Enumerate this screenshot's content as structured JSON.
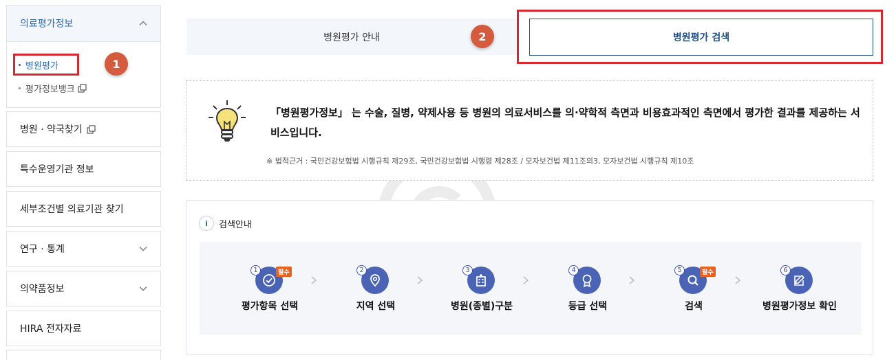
{
  "sidebar": {
    "group_title": "의료평가정보",
    "sub_items": [
      {
        "label": "병원평가"
      },
      {
        "label": "평가정보뱅크"
      }
    ],
    "items": [
      {
        "label": "병원 · 약국찾기"
      },
      {
        "label": "특수운영기관 정보"
      },
      {
        "label": "세부조건별 의료기관 찾기"
      },
      {
        "label": "연구 · 통계"
      },
      {
        "label": "의약품정보"
      },
      {
        "label": "HIRA 전자자료"
      }
    ]
  },
  "markers": {
    "one": "1",
    "two": "2"
  },
  "tabs": {
    "guide": "병원평가 안내",
    "search": "병원평가 검색"
  },
  "info": {
    "main": "「병원평가정보」 는 수술, 질병, 약제사용 등 병원의 의료서비스를 의·약학적 측면과 비용효과적인 측면에서 평가한 결과를 제공하는 서비스입니다.",
    "law": "※ 법적근거 : 국민건강보험법 시행규칙 제29조, 국민건강보험법 시행령 제28조 / 모자보건법 제11조의3, 모자보건법 시행규칙 제10조"
  },
  "guide": {
    "icon_text": "i",
    "title": "검색안내",
    "required": "필수",
    "steps": [
      {
        "num": "1",
        "label": "평가항목 선택",
        "icon": "check-icon"
      },
      {
        "num": "2",
        "label": "지역 선택",
        "icon": "location-pin-icon"
      },
      {
        "num": "3",
        "label": "병원(종별)구분",
        "icon": "hospital-building-icon"
      },
      {
        "num": "4",
        "label": "등급 선택",
        "icon": "award-icon"
      },
      {
        "num": "5",
        "label": "검색",
        "icon": "search-icon"
      },
      {
        "num": "6",
        "label": "병원평가정보 확인",
        "icon": "edit-icon"
      }
    ]
  },
  "colors": {
    "accent": "#2d6ab1",
    "highlight_red": "#d7282f",
    "step_blue": "#4a63b4",
    "required_orange": "#e8621e"
  }
}
